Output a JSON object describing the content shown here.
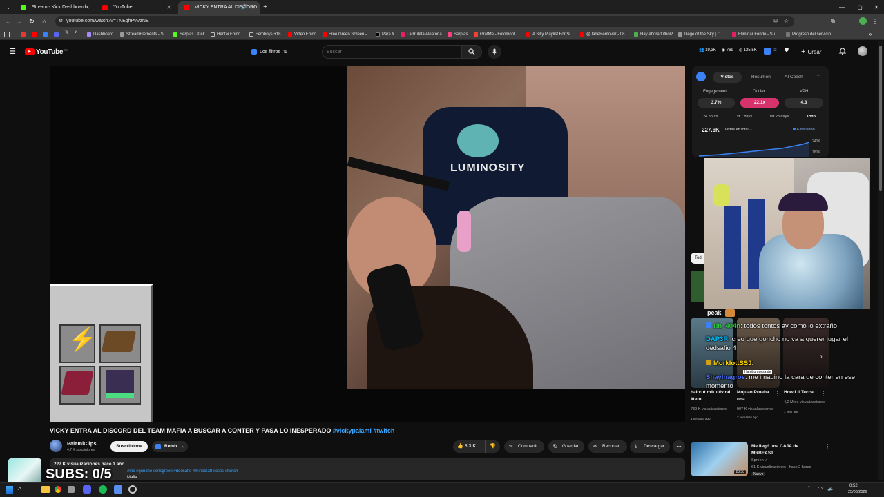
{
  "browser": {
    "tabs": [
      {
        "label": "Stream - Kick Dashboard",
        "favicon_color": "#53fc18"
      },
      {
        "label": "YouTube",
        "favicon_color": "#ff0000"
      },
      {
        "label": "VICKY ENTRA AL DISCORD",
        "favicon_color": "#ff0000"
      }
    ],
    "url": "youtube.com/watch?v=TNEqhPvVzNE",
    "bookmarks": [
      "Dashboard",
      "StreamElements - S...",
      "Serpias | Kick",
      "Hentai Epico",
      "Femboys +18",
      "Video Epico",
      "Free Green Screen -...",
      "Para ti",
      "La Ruleta Aleatoria",
      "Serpias",
      "GrafMe - Fotomont...",
      "A Silly Playlist For Si...",
      "@JaneRemover - 08...",
      "Hay ahora fútbol?",
      "Dege of the Sky | C...",
      "Eliminar Fondo - Su...",
      "Progreso del servicio"
    ]
  },
  "youtube": {
    "logo_text": "YouTube",
    "logo_country": "ES",
    "filters_label": "Los filtros",
    "search_placeholder": "Buscar",
    "stats": [
      "19,3K",
      "769",
      "125,5K"
    ],
    "create_label": "Crear"
  },
  "video": {
    "title_main": "VICKY ENTRA AL DISCORD DEL TEAM MAFIA A BUSCAR A CONTER Y PASA LO INESPERADO",
    "title_tags": "#vickypalami #twitch",
    "channel_name": "PalamiClips",
    "subscribers": "4,7 K suscriptores",
    "subscribe_label": "Suscribirme",
    "remix_label": "Remix",
    "likes": "8,3 K",
    "share_label": "Compartir",
    "save_label": "Guardar",
    "clip_label": "Recortar",
    "download_label": "Descargar",
    "views_date": "227 K visualizaciones  hace 1 año",
    "hashtags": "#mc #goncho #crisgreen #dedsafio #minecraft #clips #twitch",
    "desc_tail": "Mafia",
    "camera_brand": "LUMINOSITY"
  },
  "analytics": {
    "tabs": [
      "Vistas",
      "Resumen",
      "AI Coach"
    ],
    "metrics": [
      {
        "label": "Engagement",
        "value": "3.7%"
      },
      {
        "label": "Outlier",
        "value": "22.1x"
      },
      {
        "label": "VPH",
        "value": "4.3"
      }
    ],
    "ranges": [
      "24 hours",
      "1st 7 days",
      "1st 28 days",
      "Todo"
    ],
    "total_views": "227.6K",
    "total_label": "vistas en total",
    "this_video": "Este video",
    "axis_high": "240K",
    "axis_low": "180K"
  },
  "chat": {
    "peak_label": "peak",
    "messages": [
      {
        "user": "rih_404n",
        "text": "todos tontos ay como lo extraño",
        "color": "#2ecc40"
      },
      {
        "user": "DAP3R",
        "text": "creo que goncho no va a querer jugar el dedsafio 4",
        "color": "#00bfff"
      },
      {
        "user": "MorklottSSJ",
        "text": "",
        "color": "#ffd700"
      },
      {
        "user": "Shaylnagros",
        "text": "me imagino la cara de conter en ese momento",
        "color": "#4a6cff"
      }
    ],
    "sticker_caption": "Hamburguesa de"
  },
  "recommended": {
    "chip": "Tod",
    "shorts": [
      {
        "title": "haircut miku #viral #teto...",
        "views": "789 K visualizaciones",
        "age": "1 semana ago"
      },
      {
        "title": "Mojuan Prueba una...",
        "views": "907 K visualizaciones",
        "age": "3 semanas ago"
      },
      {
        "title": "How Lil Tecca ...",
        "views": "4,2 M de visualizaciones",
        "age": "1 year ago"
      }
    ],
    "video": {
      "title": "Me llegó una CAJA de MRBEAST",
      "channel": "Spreen",
      "meta": "61 K visualizaciones · hace 2 horas",
      "badge": "Nuevo",
      "duration": "23:58"
    }
  },
  "overlay": {
    "subs_goal": "SUBS: 0/5"
  },
  "taskbar": {
    "time": "0:52",
    "date": "25/03/2026"
  },
  "colors": {
    "accent_red": "#ff0033",
    "outlier_pink": "#d6336c",
    "link_blue": "#3ea6ff"
  }
}
